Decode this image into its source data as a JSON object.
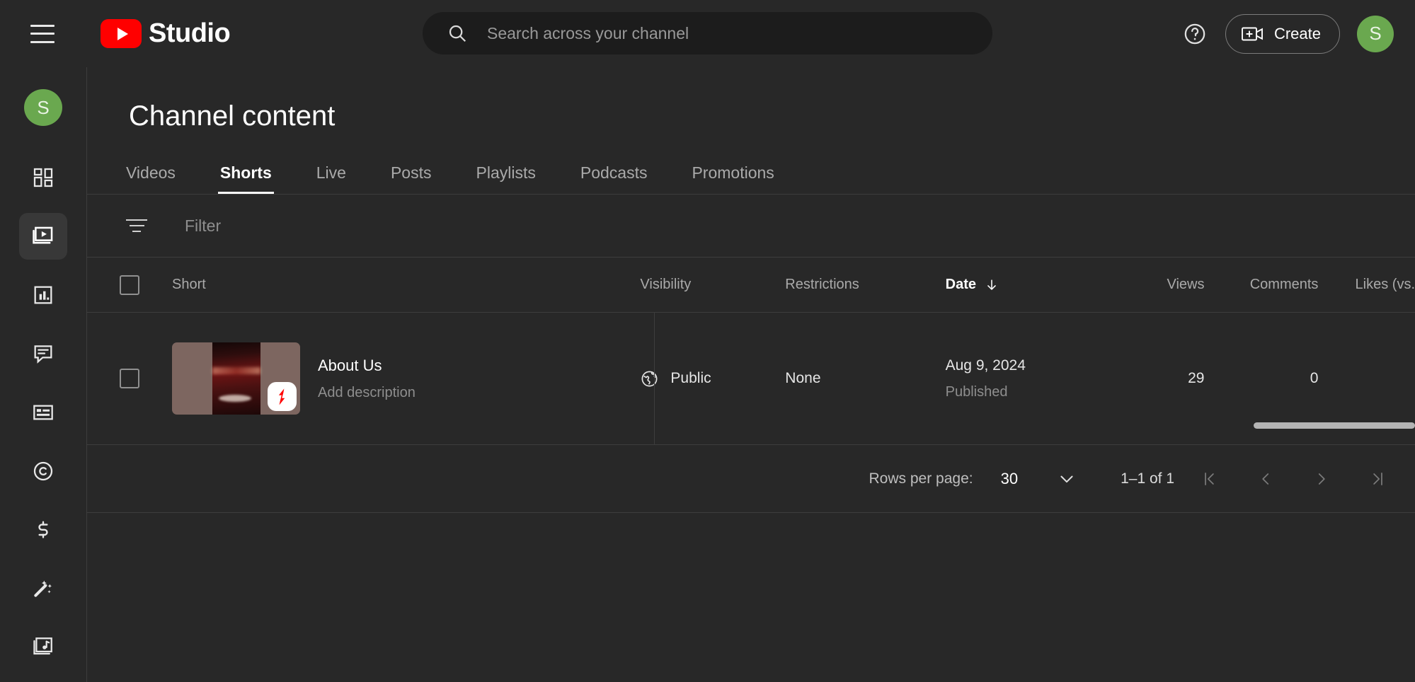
{
  "header": {
    "menu_icon": "hamburger-menu-icon",
    "logo_text": "Studio",
    "search": {
      "placeholder": "Search across your channel",
      "value": "",
      "icon": "search-icon"
    },
    "help_icon": "help-circle-icon",
    "create_label": "Create",
    "create_icon": "video-plus-icon",
    "avatar_initial": "S",
    "avatar_color": "#6aa84f"
  },
  "sidebar": {
    "avatar_initial": "S",
    "items": [
      {
        "name": "dashboard",
        "icon": "dashboard-grid-icon",
        "active": false
      },
      {
        "name": "content",
        "icon": "video-library-icon",
        "active": true
      },
      {
        "name": "analytics",
        "icon": "bar-chart-icon",
        "active": false
      },
      {
        "name": "comments",
        "icon": "comment-bubble-icon",
        "active": false
      },
      {
        "name": "subtitles",
        "icon": "subtitles-icon",
        "active": false
      },
      {
        "name": "copyright",
        "icon": "copyright-icon",
        "active": false
      },
      {
        "name": "earn",
        "icon": "dollar-sign-icon",
        "active": false
      },
      {
        "name": "customization",
        "icon": "magic-wand-icon",
        "active": false
      },
      {
        "name": "audio-library",
        "icon": "music-note-icon",
        "active": false
      }
    ]
  },
  "main": {
    "title": "Channel content",
    "tabs": [
      {
        "label": "Videos",
        "active": false
      },
      {
        "label": "Shorts",
        "active": true
      },
      {
        "label": "Live",
        "active": false
      },
      {
        "label": "Posts",
        "active": false
      },
      {
        "label": "Playlists",
        "active": false
      },
      {
        "label": "Podcasts",
        "active": false
      },
      {
        "label": "Promotions",
        "active": false
      }
    ],
    "filter": {
      "placeholder": "Filter",
      "value": "",
      "icon": "filter-icon"
    },
    "table": {
      "columns": {
        "short": "Short",
        "visibility": "Visibility",
        "restrictions": "Restrictions",
        "date": "Date",
        "views": "Views",
        "comments": "Comments",
        "likes": "Likes (vs."
      },
      "sort_column": "Date",
      "sort_icon": "arrow-down-icon",
      "rows": [
        {
          "title": "About Us",
          "description": "Add description",
          "visibility": "Public",
          "visibility_icon": "globe-icon",
          "restrictions": "None",
          "date": "Aug 9, 2024",
          "date_status": "Published",
          "views": "29",
          "comments": "0",
          "badge": "shorts-badge-icon"
        }
      ]
    },
    "pagination": {
      "rows_per_page_label": "Rows per page:",
      "rows_per_page_value": "30",
      "range": "1–1 of 1",
      "first_icon": "first-page-icon",
      "prev_icon": "prev-page-icon",
      "next_icon": "next-page-icon",
      "last_icon": "last-page-icon"
    }
  }
}
